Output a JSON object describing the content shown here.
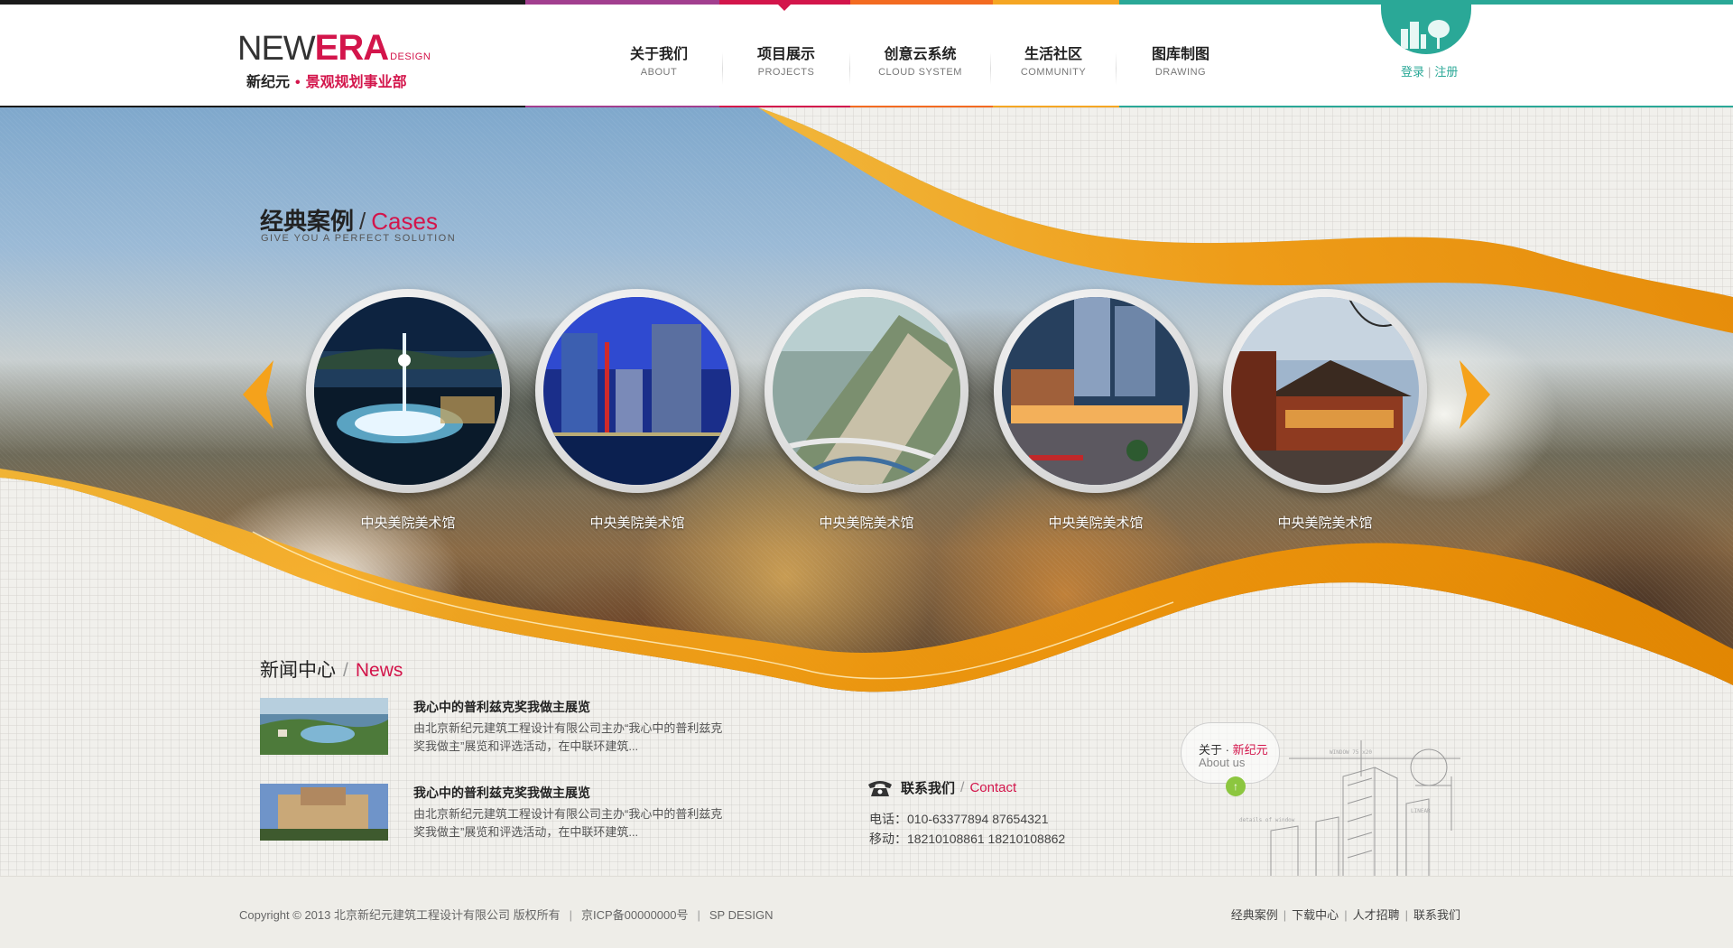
{
  "colors": {
    "brand": "#d3154b",
    "teal": "#2aa897",
    "orange_wave": "#f5a21b",
    "top_strip": [
      "#1a1a1a",
      "#a23f8f",
      "#d3154b",
      "#f36b21",
      "#f5a623",
      "#2aa897"
    ]
  },
  "header": {
    "logo": {
      "new": "NEW",
      "era": "ERA",
      "design": "DESIGN",
      "cn_name": "新纪元",
      "cn_dept": "景观规划事业部"
    },
    "nav": [
      {
        "cn": "关于我们",
        "en": "ABOUT"
      },
      {
        "cn": "项目展示",
        "en": "PROJECTS"
      },
      {
        "cn": "创意云系统",
        "en": "CLOUD SYSTEM"
      },
      {
        "cn": "生活社区",
        "en": "COMMUNITY"
      },
      {
        "cn": "图库制图",
        "en": "DRAWING"
      }
    ],
    "login": "登录",
    "register": "注册"
  },
  "cases": {
    "title_cn": "经典案例",
    "title_en": "Cases",
    "subtitle": "GIVE YOU A PERFECT SOLUTION",
    "prev_icon": "chevron-left-icon",
    "next_icon": "chevron-right-icon",
    "items": [
      {
        "label": "中央美院美术馆"
      },
      {
        "label": "中央美院美术馆"
      },
      {
        "label": "中央美院美术馆"
      },
      {
        "label": "中央美院美术馆"
      },
      {
        "label": "中央美院美术馆"
      }
    ]
  },
  "news": {
    "title_cn": "新闻中心",
    "title_en": "News",
    "items": [
      {
        "title": "我心中的普利兹克奖我做主展览",
        "body": "由北京新纪元建筑工程设计有限公司主办“我心中的普利兹克奖我做主”展览和评选活动，在中联环建筑..."
      },
      {
        "title": "我心中的普利兹克奖我做主展览",
        "body": "由北京新纪元建筑工程设计有限公司主办“我心中的普利兹克奖我做主”展览和评选活动，在中联环建筑..."
      }
    ]
  },
  "contact": {
    "title_cn": "联系我们",
    "title_en": "Contact",
    "phone": "电话：010-63377894   87654321",
    "mobile": "移动：18210108861   18210108862"
  },
  "about": {
    "prefix": "关于 · ",
    "name": "新纪元",
    "en": "About us",
    "button": "↑"
  },
  "footer": {
    "copyright": "Copyright  © 2013 北京新纪元建筑工程设计有限公司  版权所有",
    "icp": "京ICP备00000000号",
    "design": "SP DESIGN",
    "links": [
      "经典案例",
      "下载中心",
      "人才招聘",
      "联系我们"
    ]
  }
}
